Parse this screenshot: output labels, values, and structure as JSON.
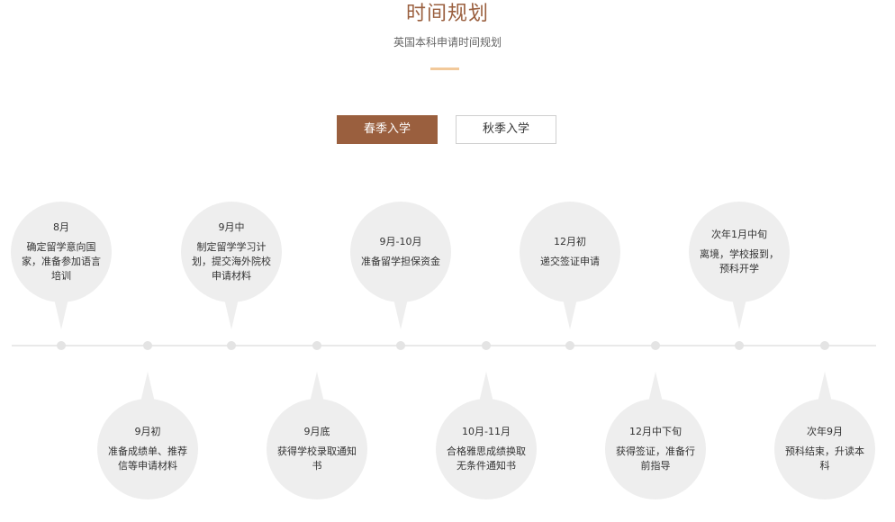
{
  "header": {
    "title": "时间规划",
    "subtitle": "英国本科申请时间规划"
  },
  "tabs": [
    {
      "label": "春季入学",
      "active": true
    },
    {
      "label": "秋季入学",
      "active": false
    }
  ],
  "colors": {
    "accent": "#9a5f3e",
    "underline": "#f2c99a",
    "bubble": "#eeeeee"
  },
  "timeline": {
    "events": [
      {
        "date": "8月",
        "desc": "确定留学意向国家，准备参加语言培训",
        "pos": "top"
      },
      {
        "date": "9月初",
        "desc": "准备成绩单、推荐信等申请材料",
        "pos": "bottom"
      },
      {
        "date": "9月中",
        "desc": "制定留学学习计划，提交海外院校申请材料",
        "pos": "top"
      },
      {
        "date": "9月底",
        "desc": "获得学校录取通知书",
        "pos": "bottom"
      },
      {
        "date": "9月-10月",
        "desc": "准备留学担保资金",
        "pos": "top"
      },
      {
        "date": "10月-11月",
        "desc": "合格雅思成绩换取无条件通知书",
        "pos": "bottom"
      },
      {
        "date": "12月初",
        "desc": "递交签证申请",
        "pos": "top"
      },
      {
        "date": "12月中下旬",
        "desc": "获得签证，准备行前指导",
        "pos": "bottom"
      },
      {
        "date": "次年1月中旬",
        "desc": "离境，学校报到，预科开学",
        "pos": "top"
      },
      {
        "date": "次年9月",
        "desc": "预科结束，升读本科",
        "pos": "bottom"
      }
    ]
  }
}
